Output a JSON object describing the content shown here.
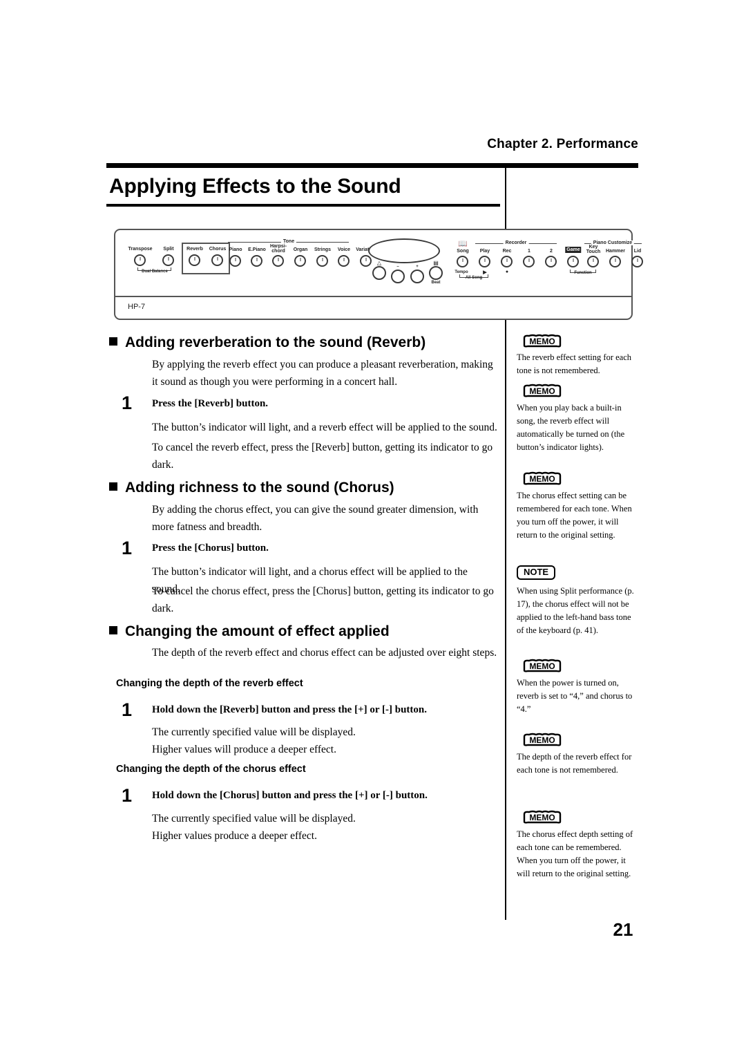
{
  "header": {
    "chapter": "Chapter 2. Performance",
    "title": "Applying Effects to the Sound"
  },
  "panel": {
    "model": "HP-7",
    "groups": {
      "tone": "Tone",
      "recorder": "Recorder",
      "piano_customize": "Piano Customize"
    },
    "brackets": {
      "dual_balance": "Dual Balance",
      "all_song": "All Song",
      "function": "Function"
    },
    "buttons": [
      {
        "label": "Transpose"
      },
      {
        "label": "Split"
      },
      {
        "label": "Reverb"
      },
      {
        "label": "Chorus"
      },
      {
        "label": "Piano"
      },
      {
        "label": "E.Piano"
      },
      {
        "label": "Harpsi-\nchord"
      },
      {
        "label": "Organ"
      },
      {
        "label": "Strings"
      },
      {
        "label": "Voice"
      },
      {
        "label": "Variation"
      },
      {
        "label": "Song"
      },
      {
        "label": "Play"
      },
      {
        "label": "Rec"
      },
      {
        "label": "1"
      },
      {
        "label": "2"
      },
      {
        "label": "Game"
      },
      {
        "label": "Key\nTouch"
      },
      {
        "label": "Hammer"
      },
      {
        "label": "Lid"
      }
    ],
    "labels": {
      "transpose": "Transpose",
      "split": "Split",
      "reverb": "Reverb",
      "chorus": "Chorus",
      "piano": "Piano",
      "epiano": "E.Piano",
      "harpsichord_1": "Harpsi-",
      "harpsichord_2": "chord",
      "organ": "Organ",
      "strings": "Strings",
      "voice": "Voice",
      "variation": "Variation",
      "song": "Song",
      "play": "Play",
      "rec": "Rec",
      "one": "1",
      "two": "2",
      "game": "Game",
      "keytouch_1": "Key",
      "keytouch_2": "Touch",
      "hammer": "Hammer",
      "lid": "Lid",
      "tempo": "Tempo",
      "beat": "Beat",
      "minus": "–",
      "plus": "+",
      "play_symbol": "▶",
      "rec_symbol": "●"
    }
  },
  "sections": {
    "reverb": {
      "heading": "Adding reverberation to the sound (Reverb)",
      "intro": "By applying the reverb effect you can produce a pleasant reverberation, making it sound as though you were performing in a concert hall.",
      "step_number": "1",
      "step_title": "Press the [Reverb] button.",
      "body_1": "The button’s indicator will light, and a reverb effect will be applied to the sound.",
      "body_2": "To cancel the reverb effect, press the [Reverb] button, getting its indicator to go dark."
    },
    "chorus": {
      "heading": "Adding richness to the sound (Chorus)",
      "intro": "By adding the chorus effect, you can give the sound greater dimension, with more fatness and breadth.",
      "step_number": "1",
      "step_title": "Press the [Chorus] button.",
      "body_1": "The button’s indicator will light, and a chorus effect will be applied to the sound.",
      "body_2": "To cancel the chorus effect, press the [Chorus] button, getting its indicator to go dark."
    },
    "amount": {
      "heading": "Changing the amount of effect applied",
      "intro": "The depth of the reverb effect and chorus effect can be adjusted over eight steps.",
      "reverb_sub": {
        "heading": "Changing the depth of the reverb effect",
        "step_number": "1",
        "step_title": "Hold down the [Reverb] button and press the [+] or [-] button.",
        "body_1": "The currently specified value will be displayed.",
        "body_2": "Higher values will produce a deeper effect."
      },
      "chorus_sub": {
        "heading": "Changing the depth of the chorus effect",
        "step_number": "1",
        "step_title": "Hold down the [Chorus] button and press the [+] or [-] button.",
        "body_1": "The currently specified value will be displayed.",
        "body_2": "Higher values produce a deeper effect."
      }
    }
  },
  "sidebar": {
    "memo_label": "MEMO",
    "note_label": "NOTE",
    "items": [
      {
        "type": "memo",
        "text": "The reverb effect setting for each tone is not remembered."
      },
      {
        "type": "memo",
        "text": "When you play back a built-in song, the reverb effect will automatically be turned on (the button’s indicator lights)."
      },
      {
        "type": "memo",
        "text": "The chorus effect setting can be remembered for each tone. When you turn off the power, it will return to the original setting."
      },
      {
        "type": "note",
        "text": "When using Split performance (p. 17), the chorus effect will not be applied to the left-hand bass tone of the keyboard (p. 41)."
      },
      {
        "type": "memo",
        "text": "When the power is turned on, reverb is set to “4,” and chorus to “4.”"
      },
      {
        "type": "memo",
        "text": "The depth of the reverb effect for each tone is not remembered."
      },
      {
        "type": "memo",
        "text": "The chorus effect depth setting of each tone can be remembered. When you turn off the power, it will return to the original setting."
      }
    ]
  },
  "footer": {
    "page_number": "21"
  }
}
